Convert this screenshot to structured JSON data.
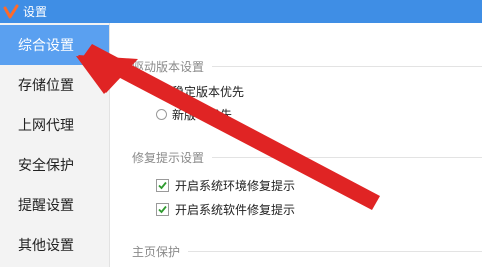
{
  "window": {
    "title": "设置"
  },
  "sidebar": {
    "items": [
      {
        "label": "综合设置",
        "active": true
      },
      {
        "label": "存储位置"
      },
      {
        "label": "上网代理"
      },
      {
        "label": "安全保护"
      },
      {
        "label": "提醒设置"
      },
      {
        "label": "其他设置"
      }
    ]
  },
  "content": {
    "driver_section": {
      "title": "驱动版本设置",
      "options": [
        "稳定版本优先",
        "新版本优先"
      ],
      "selected": "稳定版本优先"
    },
    "repair_section": {
      "title": "修复提示设置",
      "checkboxes": [
        {
          "label": "开启系统环境修复提示",
          "checked": true
        },
        {
          "label": "开启系统软件修复提示",
          "checked": true
        }
      ]
    },
    "home_section": {
      "title": "主页保护"
    }
  },
  "colors": {
    "titlebar": "#3f8ee5",
    "active_item": "#5aa0f0",
    "arrow": "#e02424",
    "check": "#2e9a2e"
  },
  "overlay": {
    "icon": "red-arrow-annotation"
  }
}
